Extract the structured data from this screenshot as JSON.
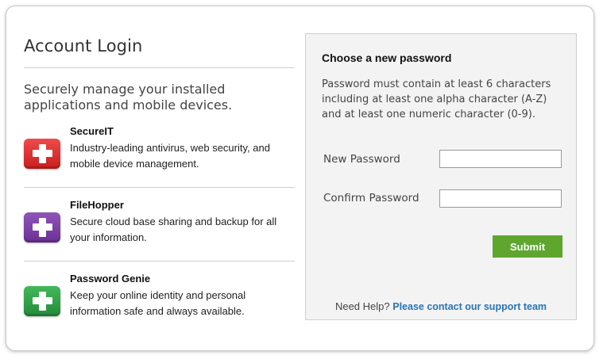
{
  "left": {
    "title": "Account Login",
    "tagline": "Securely manage your installed applications and mobile devices.",
    "apps": [
      {
        "name": "SecureIT",
        "description": "Industry-leading antivirus, web security, and mobile device management.",
        "icon": "plus-icon",
        "color": "#e03030"
      },
      {
        "name": "FileHopper",
        "description": "Secure cloud base sharing and backup for all your information.",
        "icon": "plus-icon",
        "color": "#7a3fa4"
      },
      {
        "name": "Password Genie",
        "description": "Keep your online identity and personal information safe and always available.",
        "icon": "plus-icon",
        "color": "#2fa04a"
      }
    ]
  },
  "panel": {
    "title": "Choose a new password",
    "rules": "Password must contain at least 6 characters including at least one alpha character (A-Z) and at least one numeric character (0-9).",
    "new_password_label": "New Password",
    "new_password_value": "",
    "confirm_password_label": "Confirm Password",
    "confirm_password_value": "",
    "submit_label": "Submit",
    "help_text": "Need Help?",
    "help_link": "Please contact our support team"
  },
  "colors": {
    "submit": "#5fa62f",
    "link": "#2a74b5"
  }
}
